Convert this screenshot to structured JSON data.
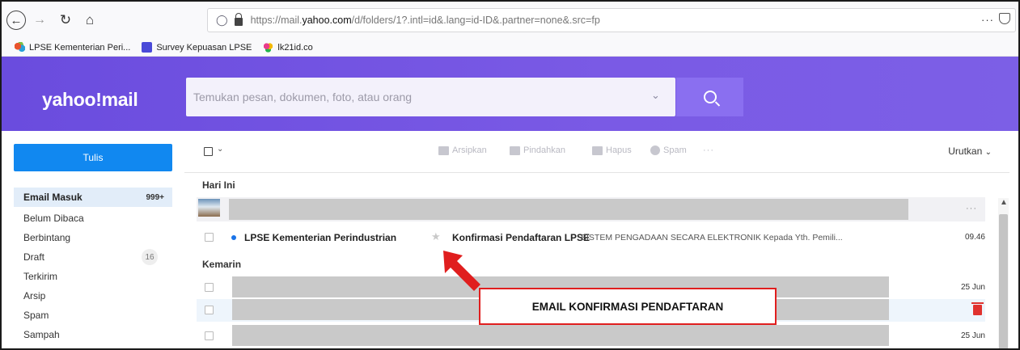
{
  "browser": {
    "url_prefix": "https://mail.",
    "url_host": "yahoo.com",
    "url_path": "/d/folders/1?.intl=id&.lang=id-ID&.partner=none&.src=fp",
    "more": "···",
    "bookmarks": [
      {
        "label": "LPSE Kementerian Peri..."
      },
      {
        "label": "Survey Kepuasan LPSE"
      },
      {
        "label": "lk21id.co"
      }
    ]
  },
  "header": {
    "logo": "yahoo!mail",
    "search_placeholder": "Temukan pesan, dokumen, foto, atau orang"
  },
  "sidebar": {
    "compose_label": "Tulis",
    "folders": [
      {
        "label": "Email Masuk",
        "count": "999+"
      },
      {
        "label": "Belum Dibaca"
      },
      {
        "label": "Berbintang"
      },
      {
        "label": "Draft",
        "count": "16"
      },
      {
        "label": "Terkirim"
      },
      {
        "label": "Arsip"
      },
      {
        "label": "Spam"
      },
      {
        "label": "Sampah"
      }
    ]
  },
  "toolbar": {
    "archive": "Arsipkan",
    "move": "Pindahkan",
    "delete": "Hapus",
    "spam": "Spam",
    "more": "···",
    "sort": "Urutkan"
  },
  "sections": {
    "today": "Hari Ini",
    "yesterday": "Kemarin"
  },
  "ad_row": {
    "more": "···"
  },
  "mail": {
    "sender": "LPSE Kementerian Perindustrian",
    "subject": "Konfirmasi Pendaftaran LPSE",
    "snippet": "SISTEM PENGADAAN SECARA ELEKTRONIK Kepada Yth. Pemili...",
    "time": "09.46"
  },
  "yesterday_rows": [
    {
      "time": "25 Jun"
    },
    {
      "time": ""
    },
    {
      "time": "25 Jun"
    }
  ],
  "annotation": {
    "label": "EMAIL KONFIRMASI PENDAFTARAN",
    "color": "#e01e1e"
  }
}
